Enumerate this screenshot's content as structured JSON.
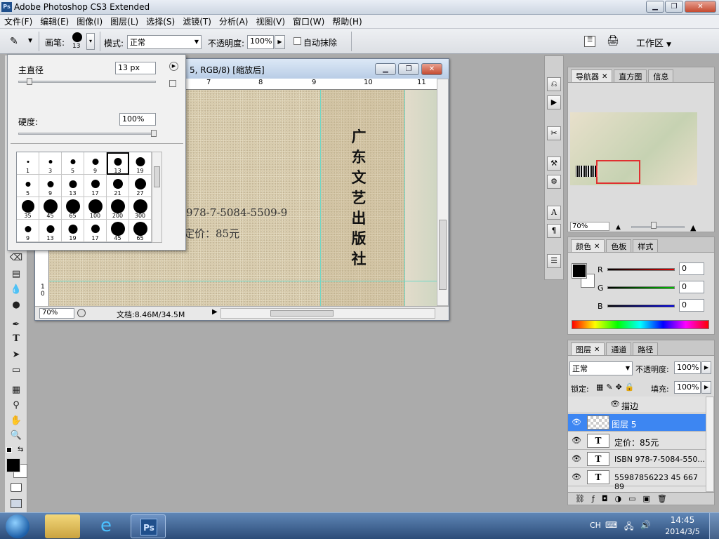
{
  "app": {
    "title": "Adobe Photoshop CS3 Extended",
    "icon_text": "Ps"
  },
  "menu": [
    "文件(F)",
    "编辑(E)",
    "图像(I)",
    "图层(L)",
    "选择(S)",
    "滤镜(T)",
    "分析(A)",
    "视图(V)",
    "窗口(W)",
    "帮助(H)"
  ],
  "options": {
    "brush_label": "画笔:",
    "brush_size_value": "13",
    "mode_label": "模式:",
    "mode_value": "正常",
    "opacity_label": "不透明度:",
    "opacity_value": "100%",
    "auto_erase_label": "自动抹除",
    "auto_erase_checked": false,
    "workspace_label": "工作区"
  },
  "brush_picker": {
    "diameter_label": "主直径",
    "diameter_value": "13 px",
    "diameter_slider_fraction": 0.06,
    "hardness_label": "硬度:",
    "hardness_value": "100%",
    "hardness_slider_fraction": 1.0,
    "presets": [
      {
        "size": "1",
        "selected": false
      },
      {
        "size": "3",
        "selected": false
      },
      {
        "size": "5",
        "selected": false
      },
      {
        "size": "9",
        "selected": false
      },
      {
        "size": "13",
        "selected": true
      },
      {
        "size": "19",
        "selected": false
      },
      {
        "size": "5",
        "selected": false
      },
      {
        "size": "9",
        "selected": false
      },
      {
        "size": "13",
        "selected": false
      },
      {
        "size": "17",
        "selected": false
      },
      {
        "size": "21",
        "selected": false
      },
      {
        "size": "27",
        "selected": false
      },
      {
        "size": "35",
        "selected": false
      },
      {
        "size": "45",
        "selected": false
      },
      {
        "size": "65",
        "selected": false
      },
      {
        "size": "100",
        "selected": false
      },
      {
        "size": "200",
        "selected": false
      },
      {
        "size": "300",
        "selected": false
      },
      {
        "size": "9",
        "selected": false
      },
      {
        "size": "13",
        "selected": false
      },
      {
        "size": "19",
        "selected": false
      },
      {
        "size": "17",
        "selected": false
      },
      {
        "size": "45",
        "selected": false
      },
      {
        "size": "65",
        "selected": false
      }
    ]
  },
  "document": {
    "title_fragment": "5, RGB/8) [缩放后]",
    "ruler_ticks": [
      "7",
      "8",
      "9",
      "10",
      "11"
    ],
    "ruler_v_ticks": [
      "1",
      "0"
    ],
    "isbn_text": "978-7-5084-5509-9",
    "price_text": "定价：85元",
    "publisher_text": [
      "广",
      "东",
      "文",
      "艺",
      "出",
      "版",
      "社"
    ],
    "zoom": "70%",
    "doc_info": "文档:8.46M/34.5M"
  },
  "navigator": {
    "tabs": [
      "导航器",
      "直方图",
      "信息"
    ],
    "zoom": "70%"
  },
  "color": {
    "tabs": [
      "颜色",
      "色板",
      "样式"
    ],
    "channels": [
      {
        "name": "R",
        "value": "0",
        "color": "#e00000"
      },
      {
        "name": "G",
        "value": "0",
        "color": "#00c000"
      },
      {
        "name": "B",
        "value": "0",
        "color": "#0000e0"
      }
    ]
  },
  "layers": {
    "tabs": [
      "图层",
      "通道",
      "路径"
    ],
    "blend_mode": "正常",
    "opacity_label": "不透明度:",
    "opacity_value": "100%",
    "lock_label": "锁定:",
    "fill_label": "填充:",
    "fill_value": "100%",
    "effect_name": "描边",
    "rows": [
      {
        "name": "图层 5",
        "type": "pixel",
        "selected": true
      },
      {
        "name": "定价：85元",
        "type": "text",
        "selected": false
      },
      {
        "name": "ISBN 978-7-5084-550...",
        "type": "text",
        "selected": false
      },
      {
        "name": "55987856223 45 667 89",
        "type": "text",
        "selected": false
      }
    ]
  },
  "taskbar": {
    "lang": "CH",
    "time": "14:45",
    "date": "2014/3/5"
  }
}
